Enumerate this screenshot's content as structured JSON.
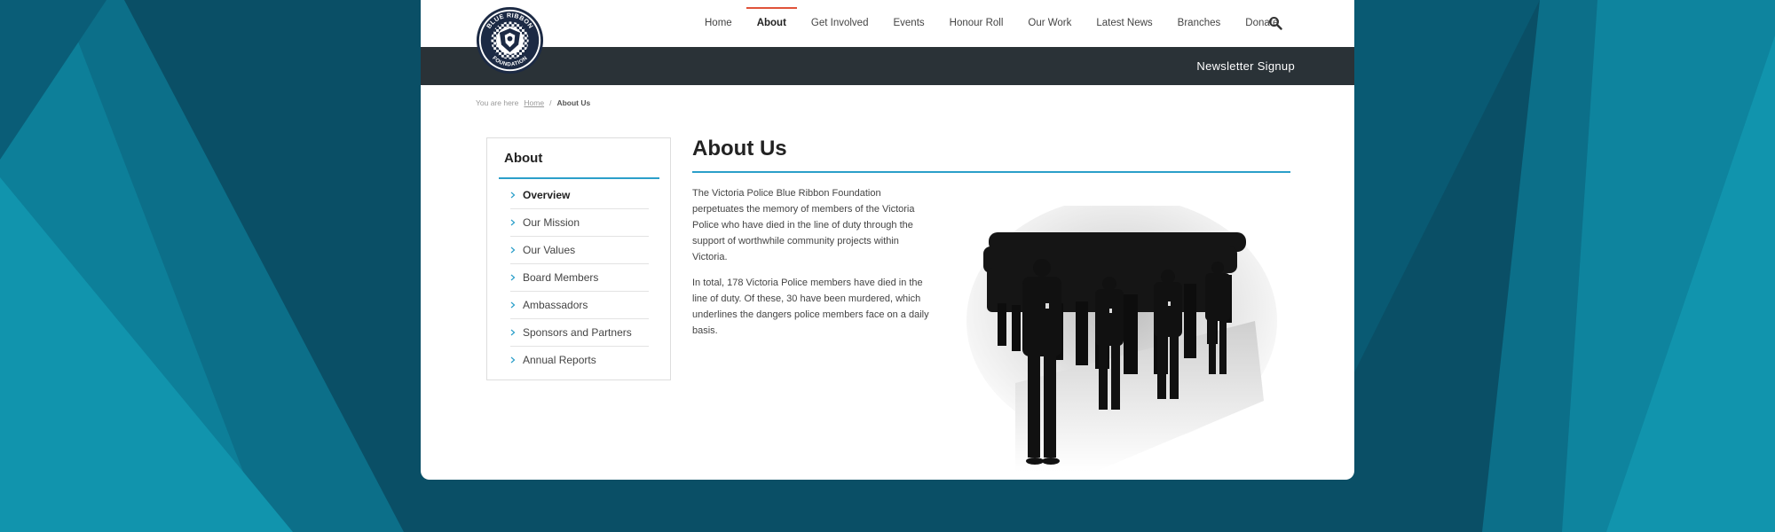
{
  "colors": {
    "accent_blue": "#2b9fc9",
    "nav_active_red": "#e0533a",
    "dark_bar": "#2a3237",
    "background_teal": "#0a4f66"
  },
  "logo": {
    "text": "BLUE RIBBON FOUNDATION"
  },
  "nav": {
    "items": [
      {
        "label": "Home"
      },
      {
        "label": "About"
      },
      {
        "label": "Get Involved"
      },
      {
        "label": "Events"
      },
      {
        "label": "Honour Roll"
      },
      {
        "label": "Our Work"
      },
      {
        "label": "Latest News"
      },
      {
        "label": "Branches"
      },
      {
        "label": "Donate"
      }
    ],
    "active": "About",
    "search_icon": "search-icon"
  },
  "subbar": {
    "newsletter": "Newsletter Signup"
  },
  "breadcrumb": {
    "prefix": "You are here",
    "home": "Home",
    "separator": "/",
    "current": "About Us"
  },
  "sidebar": {
    "title": "About",
    "items": [
      {
        "label": "Overview"
      },
      {
        "label": "Our Mission"
      },
      {
        "label": "Our Values"
      },
      {
        "label": "Board Members"
      },
      {
        "label": "Ambassadors"
      },
      {
        "label": "Sponsors and Partners"
      },
      {
        "label": "Annual Reports"
      }
    ],
    "active": "Overview"
  },
  "main": {
    "title": "About Us",
    "paragraphs": [
      "The Victoria Police Blue Ribbon Foundation perpetuates the memory of members of the Victoria Police who have died in the line of duty through the support of worthwhile community projects within Victoria.",
      "In total, 178 Victoria Police members have died in the line of duty. Of these, 30 have been murdered, which underlines the dangers police members face on a daily basis."
    ]
  }
}
